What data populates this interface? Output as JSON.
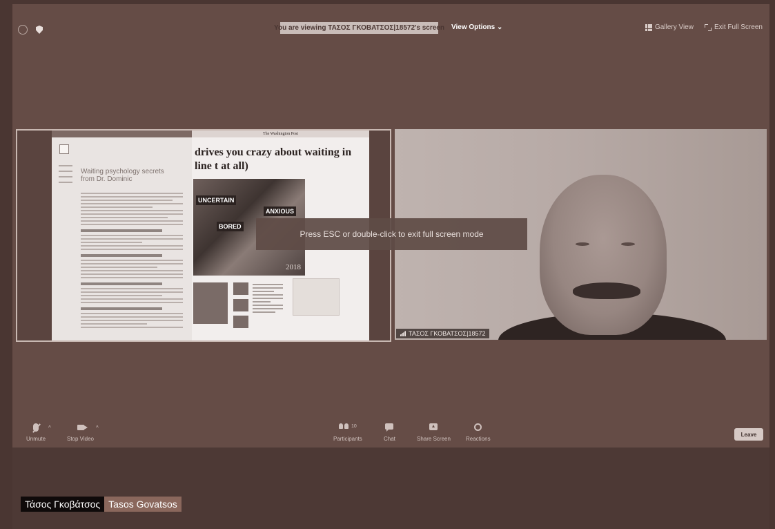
{
  "top_bar": {
    "viewing_banner": "You are viewing ΤΑΣΟΣ ΓΚΟΒΑΤΣΟΣ|18572's screen",
    "view_options": "View Options ⌄",
    "gallery_view": "Gallery View",
    "exit_full_screen": "Exit Full Screen"
  },
  "shared_screen": {
    "browser_tab": "",
    "document_title": "Waiting psychology secrets from Dr. Dominic",
    "masthead": "The Washington Post",
    "headline": "drives you crazy about waiting in line t at all)",
    "photo_labels": [
      "UNCERTAIN",
      "ANXIOUS",
      "BORED"
    ],
    "photo_credit": "2018"
  },
  "toast": {
    "message": "Press ESC or double-click to exit full screen mode"
  },
  "video": {
    "participant_name": "ΤΑΣΟΣ ΓΚΟΒΑΤΣΟΣ|18572"
  },
  "toolbar": {
    "unmute": "Unmute",
    "stop_video": "Stop Video",
    "participants": "Participants",
    "participants_count": "10",
    "chat": "Chat",
    "share_screen": "Share Screen",
    "reactions": "Reactions",
    "leave": "Leave"
  },
  "caption": {
    "greek_name": "Τάσος Γκοβάτσος",
    "latin_name": "Tasos Govatsos"
  },
  "colors": {
    "background": "#614a44",
    "frame_dark": "#4d3935",
    "caption_black": "#0f0a0a",
    "caption_brown": "#8a675c"
  }
}
